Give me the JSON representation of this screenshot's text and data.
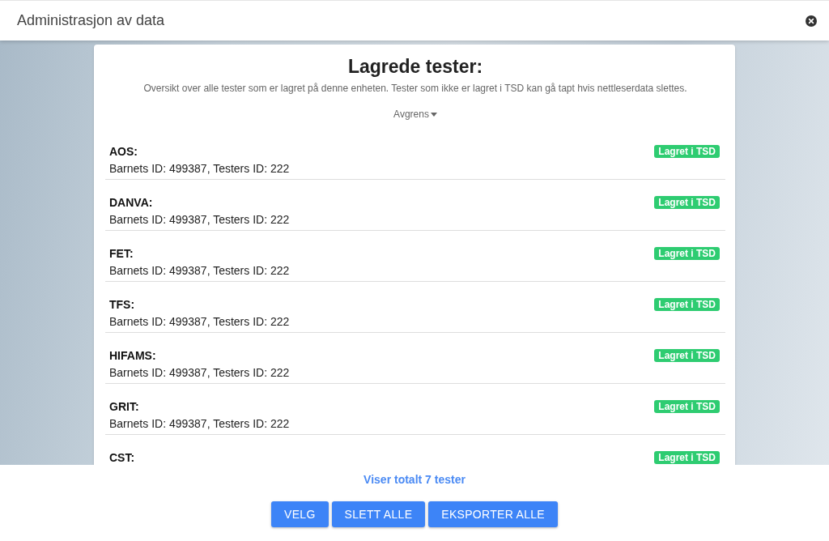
{
  "window": {
    "title": "Administrasjon av data"
  },
  "panel": {
    "title": "Lagrede tester:",
    "description": "Oversikt over alle tester som er lagret på denne enheten. Tester som ikke er lagret i TSD kan gå tapt hvis nettleserdata slettes.",
    "filter": "Avgrens"
  },
  "tests": [
    {
      "name": "AOS:",
      "details": "Barnets ID: 499387, Testers ID: 222",
      "status": "Lagret i TSD"
    },
    {
      "name": "DANVA:",
      "details": "Barnets ID: 499387, Testers ID: 222",
      "status": "Lagret i TSD"
    },
    {
      "name": "FET:",
      "details": "Barnets ID: 499387, Testers ID: 222",
      "status": "Lagret i TSD"
    },
    {
      "name": "TFS:",
      "details": "Barnets ID: 499387, Testers ID: 222",
      "status": "Lagret i TSD"
    },
    {
      "name": "HIFAMS:",
      "details": "Barnets ID: 499387, Testers ID: 222",
      "status": "Lagret i TSD"
    },
    {
      "name": "GRIT:",
      "details": "Barnets ID: 499387, Testers ID: 222",
      "status": "Lagret i TSD"
    },
    {
      "name": "CST:",
      "status": "Lagret i TSD"
    }
  ],
  "footer": {
    "summary": "Viser totalt 7 tester",
    "buttons": [
      "VELG",
      "SLETT ALLE",
      "EKSPORTER ALLE"
    ]
  }
}
